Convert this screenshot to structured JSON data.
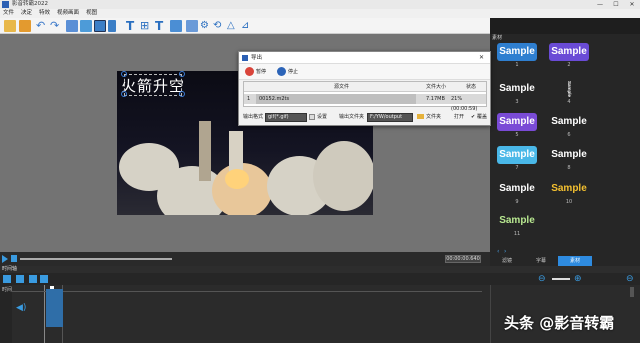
{
  "window": {
    "title": "影音转霸2022",
    "minimize": "—",
    "maximize": "☐",
    "close": "✕"
  },
  "menu": [
    "文件",
    "决定",
    "特效",
    "视频画面",
    "视图"
  ],
  "toolbar": {
    "icons": [
      "new-icon",
      "open-icon",
      "undo-icon",
      "redo-icon",
      "crop-icon",
      "image-icon",
      "text-icon",
      "text-outline-icon",
      "subtitle-icon",
      "effects-icon",
      "split-icon",
      "transition-icon",
      "mirror-icon",
      "rotate-icon"
    ]
  },
  "preview": {
    "video_text": "火箭升空",
    "timecode": "00:00:00.640"
  },
  "export_dialog": {
    "title": "导出",
    "close": "✕",
    "pause": "暂停",
    "stop": "停止",
    "columns": [
      "源文件",
      "文件大小",
      "状态"
    ],
    "rows": [
      {
        "index": "1",
        "file": "00152.m2ts",
        "size": "7.17MB",
        "status": "21% (00:00:59)"
      }
    ],
    "output_format_label": "输出格式",
    "output_format_value": "gif(*.gif)",
    "settings": "设置",
    "output_folder_label": "输出文件夹",
    "output_folder_value": "F:/YW/output",
    "folder_button": "文件夹",
    "open_button": "打开",
    "overwrite": "覆盖"
  },
  "assets": {
    "title": "素材",
    "items": [
      {
        "label": "Sample",
        "number": "1",
        "bg": "#2f7fd0",
        "fg": "#ffffff"
      },
      {
        "label": "Sample",
        "number": "2",
        "bg": "#6a4bd6",
        "fg": "#ffffff"
      },
      {
        "label": "Sample",
        "number": "3",
        "bg": "transparent",
        "fg": "#ffffff"
      },
      {
        "label": "Sample",
        "number": "4",
        "bg": "transparent",
        "fg": "#ffffff"
      },
      {
        "label": "Sample",
        "number": "5",
        "bg": "#7a4bd6",
        "fg": "#ffffff"
      },
      {
        "label": "Sample",
        "number": "6",
        "bg": "transparent",
        "fg": "#ffffff"
      },
      {
        "label": "Sample",
        "number": "7",
        "bg": "#4ab8e8",
        "fg": "#ffffff"
      },
      {
        "label": "Sample",
        "number": "8",
        "bg": "transparent",
        "fg": "#ffffff"
      },
      {
        "label": "Sample",
        "number": "9",
        "bg": "transparent",
        "fg": "#ffffff"
      },
      {
        "label": "Sample",
        "number": "10",
        "bg": "transparent",
        "fg": "#f4c030"
      },
      {
        "label": "Sample",
        "number": "11",
        "bg": "transparent",
        "fg": "#b8e890"
      }
    ],
    "tabs": [
      "滤镜",
      "字幕",
      "素材"
    ]
  },
  "timeline": {
    "header": "时间轴",
    "track_label": "时间"
  },
  "watermark": "头条 @影音转霸"
}
